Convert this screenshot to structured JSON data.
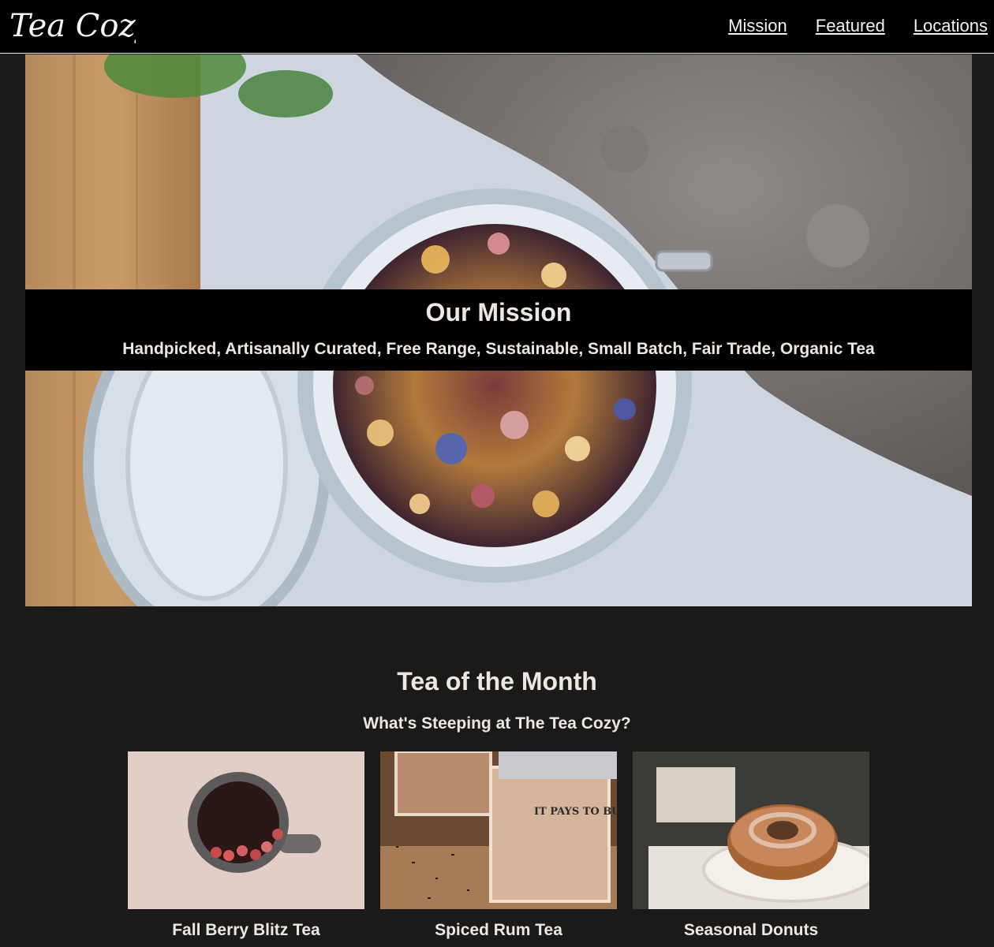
{
  "header": {
    "logo_text": "Tea Cozy",
    "nav": {
      "mission": "Mission",
      "featured": "Featured",
      "locations": "Locations"
    }
  },
  "hero": {
    "title": "Our Mission",
    "tagline": "Handpicked, Artisanally Curated, Free Range, Sustainable, Small Batch, Fair Trade, Organic Tea"
  },
  "tea_of_month": {
    "title": "Tea of the Month",
    "subtitle": "What's Steeping at The Tea Cozy?",
    "items": [
      {
        "name": "Fall Berry Blitz Tea"
      },
      {
        "name": "Spiced Rum Tea"
      },
      {
        "name": "Seasonal Donuts"
      }
    ],
    "box_sign_text": "IT PAYS TO BUY GOOD TEA"
  },
  "colors": {
    "background": "#1a1a1a",
    "header": "#000000",
    "text": "#ece7e0"
  }
}
